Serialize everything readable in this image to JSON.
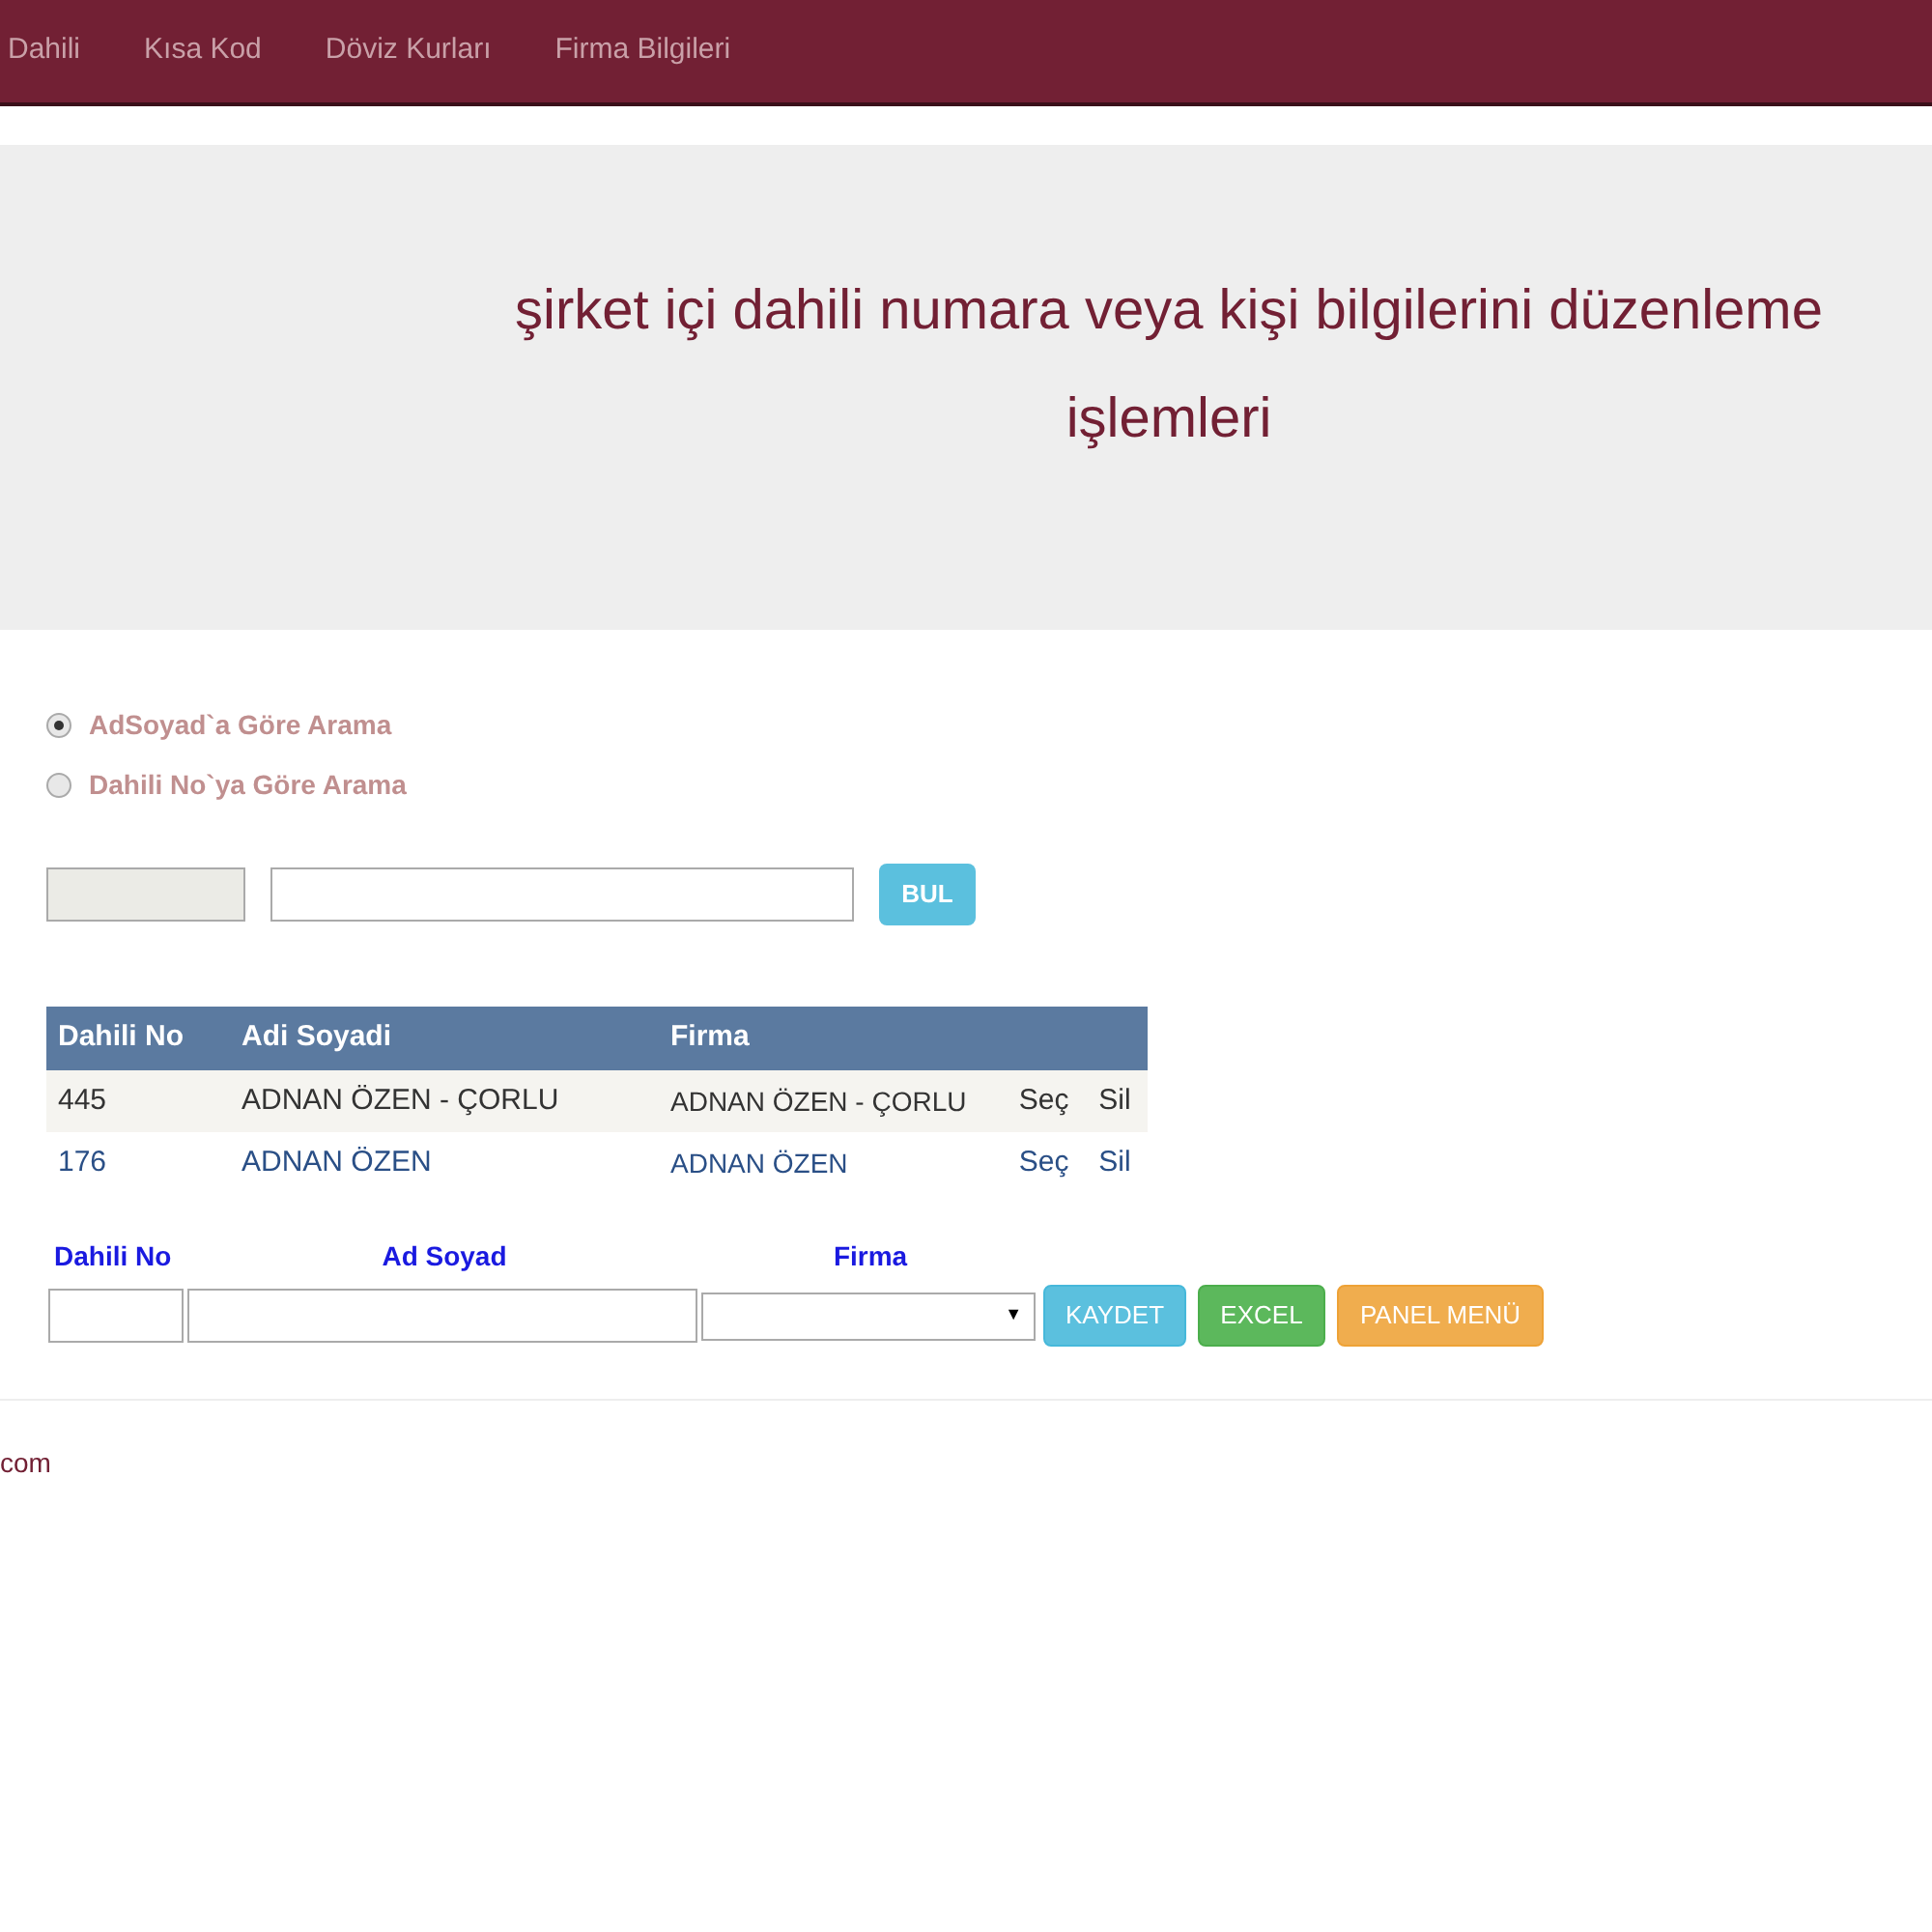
{
  "nav": [
    "Dahili",
    "Kısa Kod",
    "Döviz Kurları",
    "Firma Bilgileri"
  ],
  "hero": {
    "title": "şirket içi dahili numara veya kişi bilgilerini düzenleme işlemleri"
  },
  "search_modes": [
    {
      "label": "AdSoyad`a Göre Arama",
      "selected": true
    },
    {
      "label": "Dahili No`ya Göre Arama",
      "selected": false
    }
  ],
  "search_button": "BUL",
  "table": {
    "columns": [
      "Dahili No",
      "Adi Soyadi",
      "Firma"
    ],
    "rows": [
      {
        "cells": [
          "445",
          "ADNAN ÖZEN - ÇORLU",
          "ADNAN ÖZEN - ÇORLU"
        ],
        "actions": [
          "Seç",
          "Sil"
        ]
      },
      {
        "cells": [
          "176",
          "ADNAN ÖZEN",
          "ADNAN ÖZEN"
        ],
        "actions": [
          "Seç",
          "Sil"
        ]
      }
    ]
  },
  "form": {
    "labels": [
      "Dahili No",
      "Ad Soyad",
      "Firma"
    ],
    "dropdown_caret": "▼",
    "buttons": [
      {
        "label": "KAYDET",
        "kind": "info"
      },
      {
        "label": "EXCEL",
        "kind": "success"
      },
      {
        "label": "PANEL MENÜ",
        "kind": "warning"
      }
    ]
  },
  "footer": "com"
}
